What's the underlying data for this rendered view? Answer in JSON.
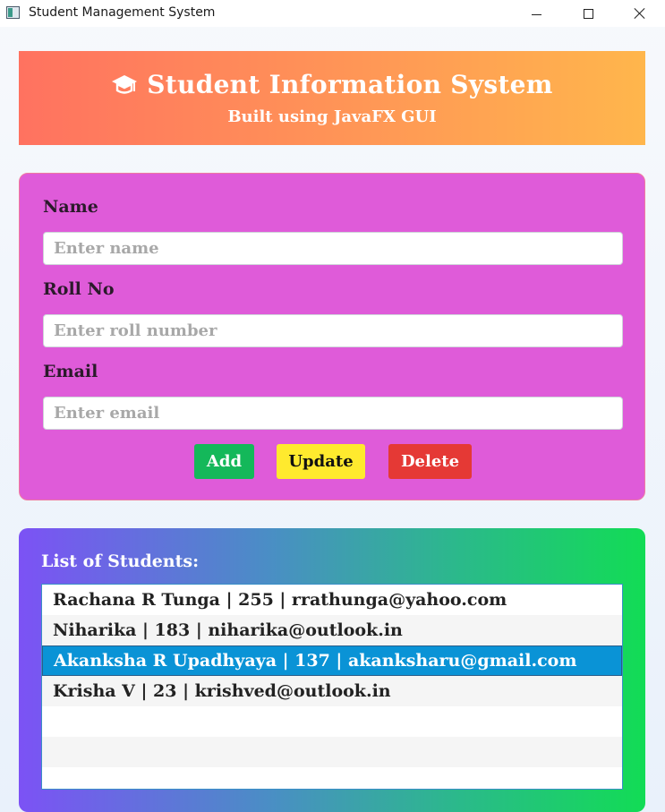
{
  "window": {
    "title": "Student Management System"
  },
  "header": {
    "title": "Student Information System",
    "subtitle": "Built using JavaFX GUI",
    "icon": "graduation-cap-icon"
  },
  "form": {
    "name_label": "Name",
    "name_placeholder": "Enter name",
    "name_value": "",
    "roll_label": "Roll No",
    "roll_placeholder": "Enter roll number",
    "roll_value": "",
    "email_label": "Email",
    "email_placeholder": "Enter email",
    "email_value": "",
    "add_label": "Add",
    "update_label": "Update",
    "delete_label": "Delete"
  },
  "students": {
    "title": "List of Students:",
    "rows": [
      "Rachana R Tunga | 255 | rrathunga@yahoo.com",
      "Niharika | 183 | niharika@outlook.in",
      "Akanksha R Upadhyaya | 137 | akanksharu@gmail.com",
      "Krisha V | 23 | krishved@outlook.in",
      "",
      "",
      ""
    ],
    "selected_index": 2
  },
  "colors": {
    "header_gradient_start": "#ff7260",
    "header_gradient_end": "#ffb64c",
    "form_bg": "#df5bd9",
    "add_button": "#14b85a",
    "update_button": "#ffea2e",
    "delete_button": "#e53935",
    "list_gradient_start": "#7c52f5",
    "list_gradient_end": "#12dc55",
    "selected_row": "#0a93d6"
  }
}
